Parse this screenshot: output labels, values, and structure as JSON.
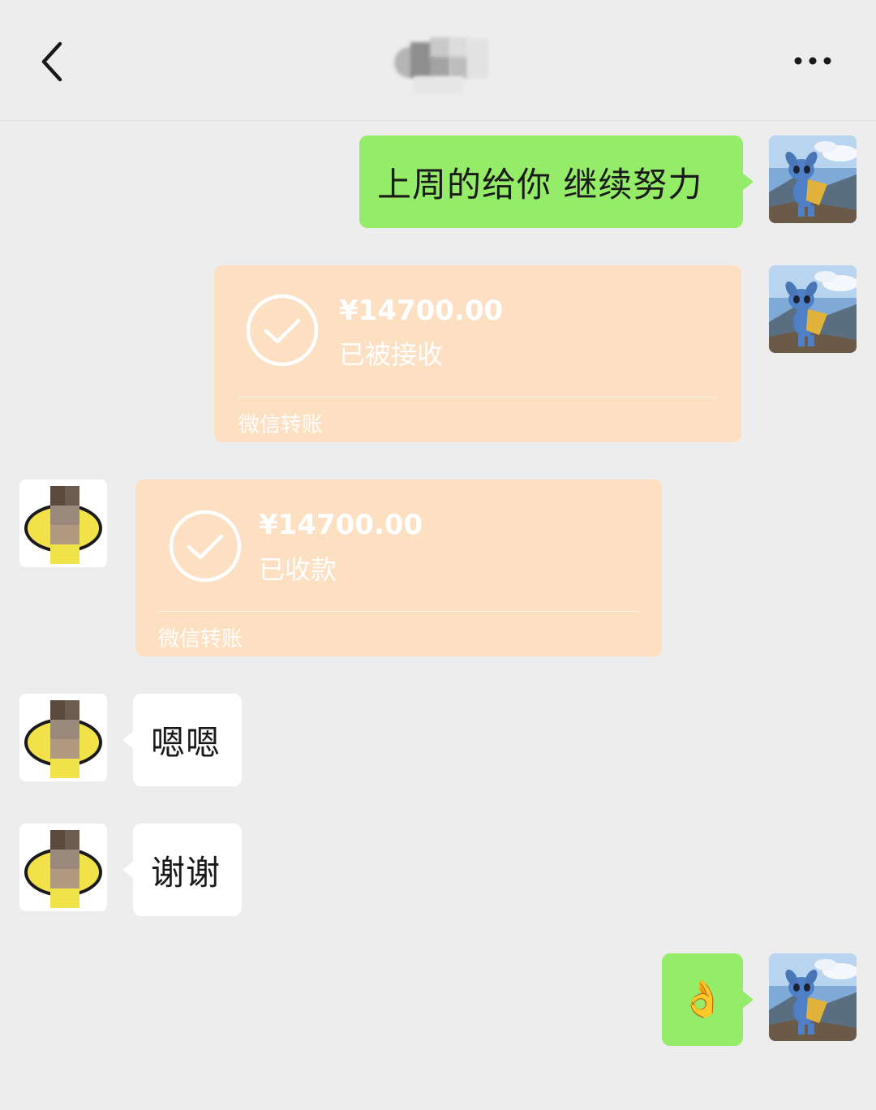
{
  "header": {
    "back_icon": "chevron-left-icon",
    "title": "",
    "more_icon": "more-horizontal-icon"
  },
  "messages": [
    {
      "side": "right",
      "type": "text",
      "text": "上周的给你  继续努力",
      "avatar": "stitch-avatar"
    },
    {
      "side": "right",
      "type": "transfer",
      "amount": "¥14700.00",
      "status": "已被接收",
      "brand": "微信转账",
      "avatar": "stitch-avatar"
    },
    {
      "side": "left",
      "type": "transfer",
      "amount": "¥14700.00",
      "status": "已收款",
      "brand": "微信转账",
      "avatar": "contact-avatar"
    },
    {
      "side": "left",
      "type": "text",
      "text": "嗯嗯",
      "avatar": "contact-avatar"
    },
    {
      "side": "left",
      "type": "text",
      "text": "谢谢",
      "avatar": "contact-avatar"
    },
    {
      "side": "right",
      "type": "emoji",
      "text": "👌",
      "avatar": "stitch-avatar"
    }
  ],
  "colors": {
    "background": "#ededed",
    "sent_bubble": "#95ec69",
    "received_bubble": "#ffffff",
    "transfer_card": "#fddfc1"
  }
}
